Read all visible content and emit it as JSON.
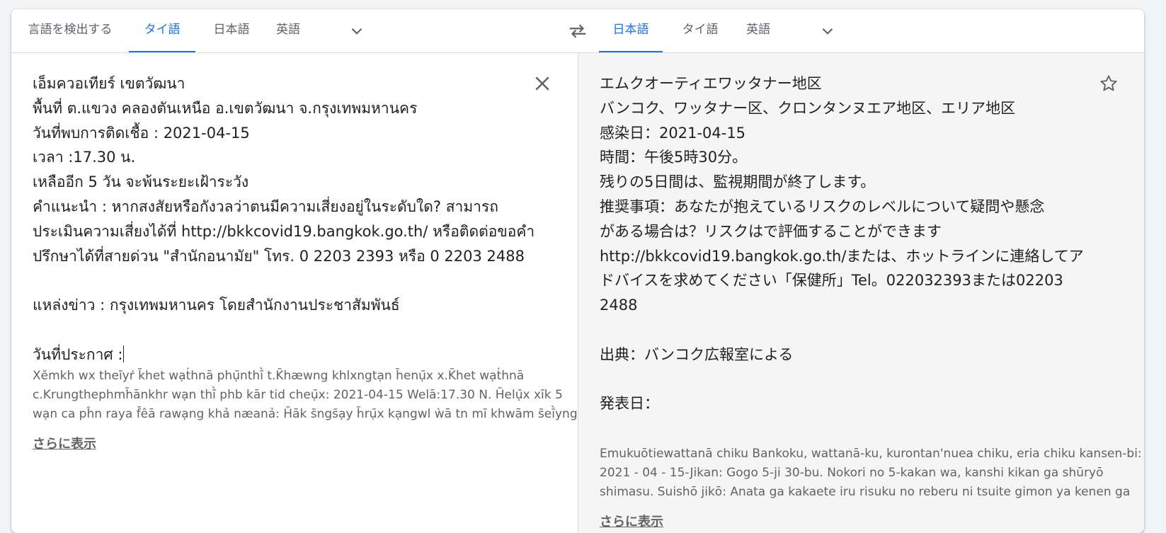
{
  "source_tabs": [
    {
      "label": "言語を検出する"
    },
    {
      "label": "タイ語"
    },
    {
      "label": "日本語"
    },
    {
      "label": "英語"
    }
  ],
  "target_tabs": [
    {
      "label": "日本語"
    },
    {
      "label": "タイ語"
    },
    {
      "label": "英語"
    }
  ],
  "source_text": [
    "เอ็มควอเทียร์ เขตวัฒนา",
    "พื้นที่ ต.แขวง คลองตันเหนือ อ.เขตวัฒนา จ.กรุงเทพมหานคร",
    "วันที่พบการติดเชื้อ : 2021-04-15",
    "เวลา :17.30 น.",
    "เหลืออีก 5 วัน จะพ้นระยะเฝ้าระวัง",
    "คำแนะนำ : หากสงสัยหรือกังวลว่าตนมีความเสี่ยงอยู่ในระดับใด? สามารถ",
    "ประเมินความเสี่ยงได้ที่ http://bkkcovid19.bangkok.go.th/ หรือติดต่อขอคำ",
    "ปรึกษาได้ที่สายด่วน \"สำนักอนามัย\" โทร. 0 2203 2393 หรือ 0 2203 2488",
    "",
    "แหล่งข่าว : กรุงเทพมหานคร โดยสำนักงานประชาสัมพันธ์",
    "",
    "วันที่ประกาศ :"
  ],
  "source_translit": [
    "Xĕmkh wx theīyr̒ k̄het wạt̒hnā phụ̄nthī̀ t.K̄hæwng khlxngtạn h̄enụ̄x x.K̄het wạt̒hnā",
    "c.Krungthephmh̄ānkhr wạn thī̀ phb kār tid cheụ̄x: 2021-04-15 Welā:17.30 N. H̄elụ̄x xīk 5",
    "wạn ca pĥn raya f̄êā rawạng khả næanả: H̄āk s̄ngs̄ạy h̄rụ̄x kạngwl ẁā tn mī khwām s̄eī̀yng"
  ],
  "target_text": [
    "エムクオーティエワッタナー地区",
    "バンコク、ワッタナー区、クロンタンヌエア地区、エリア地区",
    "感染日：2021-04-15",
    "時間：午後5時30分。",
    "残りの5日間は、監視期間が終了します。",
    "推奨事項：あなたが抱えているリスクのレベルについて疑問や懸念",
    "がある場合は？リスクはで評価することができます",
    "http://bkkcovid19.bangkok.go.th/または、ホットラインに連絡してア",
    "ドバイスを求めてください「保健所」Tel。022032393または02203",
    "2488",
    "",
    "出典：バンコク広報室による",
    "",
    "発表日："
  ],
  "target_translit": [
    "Emukuōtiewattanā chiku Bankoku, wattanā-ku, kurontan'nuea chiku, eria chiku kansen-bi:",
    "2021 - 04 - 15-Jikan: Gogo 5-ji 30-bu. Nokori no 5-kakan wa, kanshi kikan ga shūryō",
    "shimasu. Suishō jikō: Anata ga kakaete iru risuku no reberu ni tsuite gimon ya kenen ga"
  ],
  "show_more_label": "さらに表示",
  "icons": {
    "chevron": "chevron-down-icon",
    "swap": "swap-icon",
    "close": "close-icon",
    "star": "star-icon"
  },
  "colors": {
    "accent": "#1a73e8",
    "text": "#202124",
    "muted": "#5f6368",
    "target_bg": "#f5f5f5"
  }
}
